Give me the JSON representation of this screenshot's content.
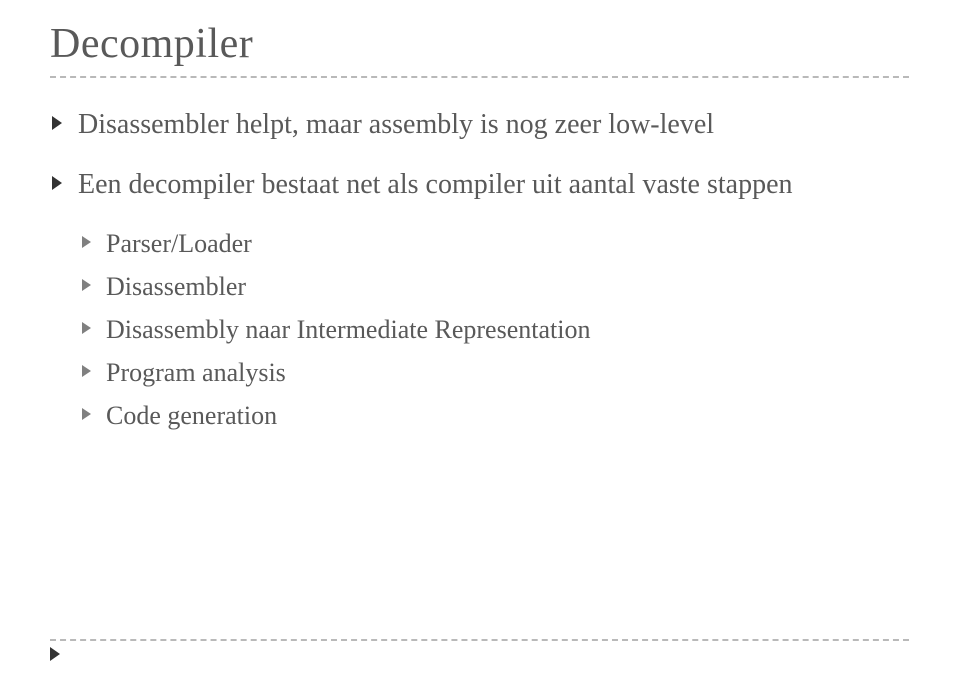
{
  "title": "Decompiler",
  "bullets": [
    {
      "text": "Disassembler helpt, maar assembly is nog zeer low-level",
      "children": []
    },
    {
      "text": "Een decompiler bestaat net als compiler uit aantal vaste stappen",
      "children": [
        "Parser/Loader",
        "Disassembler",
        "Disassembly naar Intermediate Representation",
        "Program analysis",
        "Code generation"
      ]
    }
  ]
}
